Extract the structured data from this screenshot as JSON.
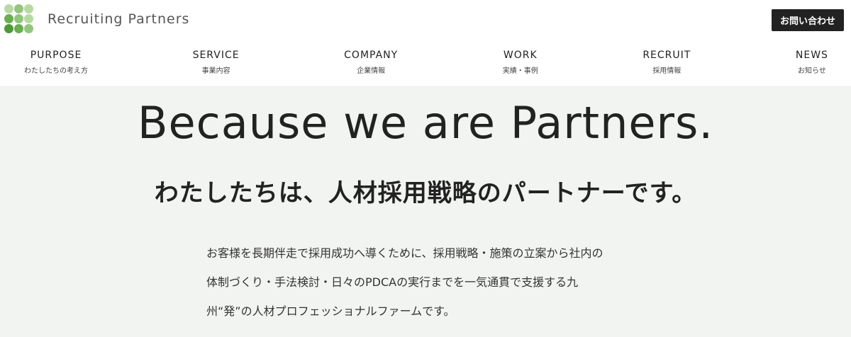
{
  "header": {
    "brand": "Recruiting Partners",
    "logo_colors": [
      "#b7d9a2",
      "#93c57e",
      "#b7d9a2",
      "#6aae4f",
      "#93c57e",
      "#b7d9a2",
      "#4e9a3a",
      "#6aae4f",
      "#93c57e"
    ],
    "contact_label": "お問い合わせ"
  },
  "nav": [
    {
      "en": "PURPOSE",
      "ja": "わたしたちの考え方"
    },
    {
      "en": "SERVICE",
      "ja": "事業内容"
    },
    {
      "en": "COMPANY",
      "ja": "企業情報"
    },
    {
      "en": "WORK",
      "ja": "実績・事例"
    },
    {
      "en": "RECRUIT",
      "ja": "採用情報"
    },
    {
      "en": "NEWS",
      "ja": "お知らせ"
    }
  ],
  "hero": {
    "headline_en": "Because we are Partners.",
    "headline_ja": "わたしたちは、人材採用戦略のパートナーです。",
    "body_lines": [
      "お客様を長期伴走で採用成功へ導くために、採用戦略・施策の立案から社内の",
      "体制づくり・手法検討・日々のPDCAの実行までを一気通貫で支援する九",
      "州“発”の人材プロフェッショナルファームです。"
    ],
    "background": "#f2f4f1"
  }
}
